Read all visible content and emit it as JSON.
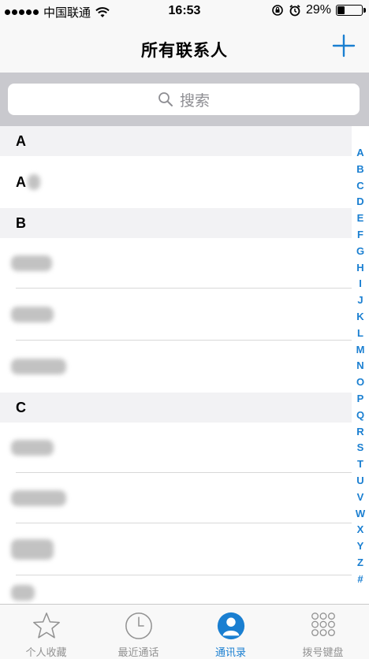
{
  "status_bar": {
    "carrier": "中国联通",
    "time": "16:53",
    "battery": "29%",
    "battery_level": 0.29
  },
  "nav": {
    "title": "所有联系人",
    "add_icon": "plus-icon"
  },
  "search": {
    "placeholder": "搜索",
    "icon": "search-icon"
  },
  "sections": [
    {
      "letter": "A",
      "rows": [
        {
          "visible_text": "A"
        }
      ]
    },
    {
      "letter": "B",
      "rows": [
        {},
        {},
        {}
      ]
    },
    {
      "letter": "C",
      "rows": [
        {},
        {},
        {},
        {}
      ]
    }
  ],
  "index_letters": [
    "A",
    "B",
    "C",
    "D",
    "E",
    "F",
    "G",
    "H",
    "I",
    "J",
    "K",
    "L",
    "M",
    "N",
    "O",
    "P",
    "Q",
    "R",
    "S",
    "T",
    "U",
    "V",
    "W",
    "X",
    "Y",
    "Z",
    "#"
  ],
  "tabs": [
    {
      "label": "个人收藏",
      "icon": "star-icon",
      "active": false
    },
    {
      "label": "最近通话",
      "icon": "clock-icon",
      "active": false
    },
    {
      "label": "通讯录",
      "icon": "contact-icon",
      "active": true
    },
    {
      "label": "拨号键盘",
      "icon": "keypad-icon",
      "active": false
    }
  ],
  "colors": {
    "accent": "#1a7fd1",
    "search_bg": "#c9c9ce",
    "section_bg": "#f2f2f4"
  }
}
